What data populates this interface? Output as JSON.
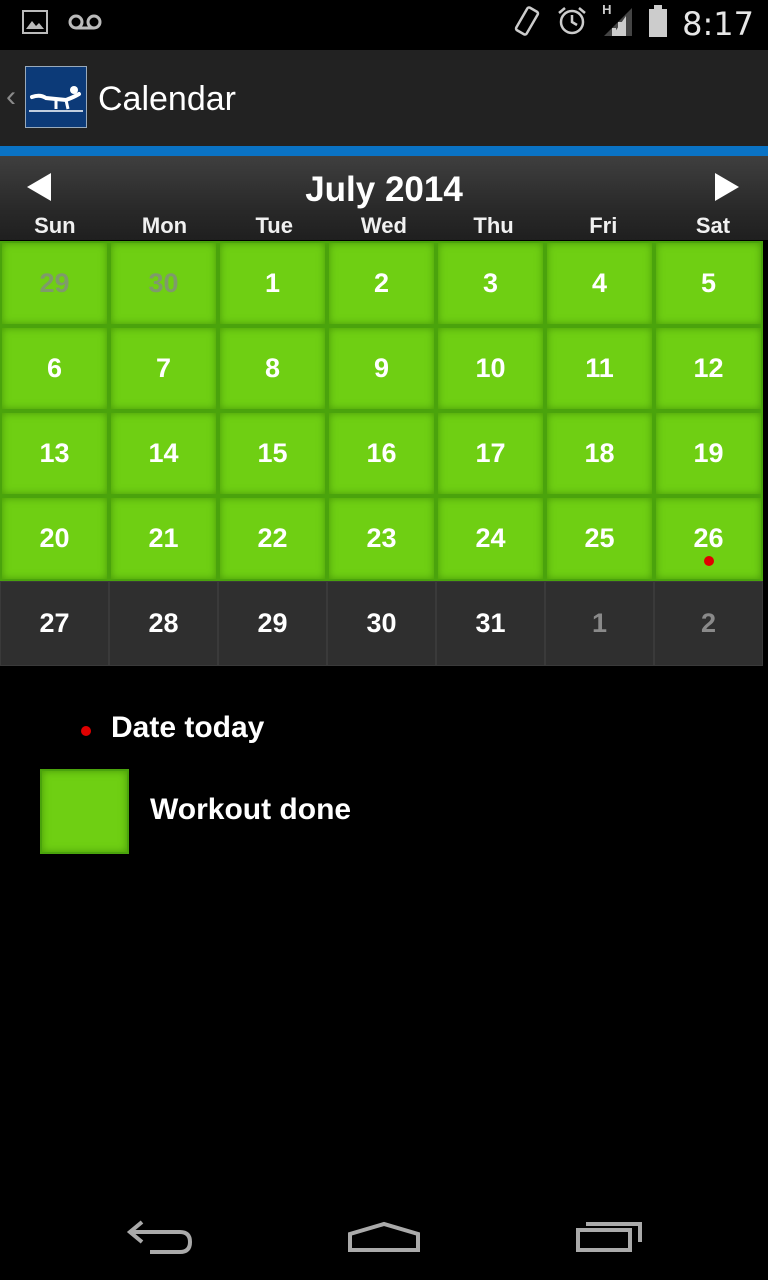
{
  "status_bar": {
    "time": "8:17",
    "network": "H",
    "icons": [
      "image-icon",
      "voicemail-icon",
      "vibrate-icon",
      "alarm-icon",
      "signal-icon",
      "battery-icon"
    ]
  },
  "action_bar": {
    "title": "Calendar",
    "back_glyph": "‹",
    "logo_icon": "pushup-logo-icon"
  },
  "calendar": {
    "month_label": "July 2014",
    "weekdays": [
      "Sun",
      "Mon",
      "Tue",
      "Wed",
      "Thu",
      "Fri",
      "Sat"
    ],
    "days": [
      {
        "day": "29",
        "done": true,
        "other": true
      },
      {
        "day": "30",
        "done": true,
        "other": true
      },
      {
        "day": "1",
        "done": true
      },
      {
        "day": "2",
        "done": true
      },
      {
        "day": "3",
        "done": true
      },
      {
        "day": "4",
        "done": true
      },
      {
        "day": "5",
        "done": true
      },
      {
        "day": "6",
        "done": true
      },
      {
        "day": "7",
        "done": true
      },
      {
        "day": "8",
        "done": true
      },
      {
        "day": "9",
        "done": true
      },
      {
        "day": "10",
        "done": true
      },
      {
        "day": "11",
        "done": true
      },
      {
        "day": "12",
        "done": true
      },
      {
        "day": "13",
        "done": true
      },
      {
        "day": "14",
        "done": true
      },
      {
        "day": "15",
        "done": true
      },
      {
        "day": "16",
        "done": true
      },
      {
        "day": "17",
        "done": true
      },
      {
        "day": "18",
        "done": true
      },
      {
        "day": "19",
        "done": true
      },
      {
        "day": "20",
        "done": true
      },
      {
        "day": "21",
        "done": true
      },
      {
        "day": "22",
        "done": true
      },
      {
        "day": "23",
        "done": true
      },
      {
        "day": "24",
        "done": true
      },
      {
        "day": "25",
        "done": true
      },
      {
        "day": "26",
        "done": true,
        "today": true
      },
      {
        "day": "27"
      },
      {
        "day": "28"
      },
      {
        "day": "29"
      },
      {
        "day": "30"
      },
      {
        "day": "31"
      },
      {
        "day": "1",
        "other": true
      },
      {
        "day": "2",
        "other": true
      }
    ]
  },
  "legend": {
    "today_label": "Date today",
    "done_label": "Workout done"
  },
  "colors": {
    "accent_blue": "#0a73c5",
    "done_green": "#6fcf13",
    "today_red": "#e00000"
  },
  "nav_bar": {
    "buttons": [
      "back-icon",
      "home-icon",
      "recent-apps-icon"
    ]
  }
}
